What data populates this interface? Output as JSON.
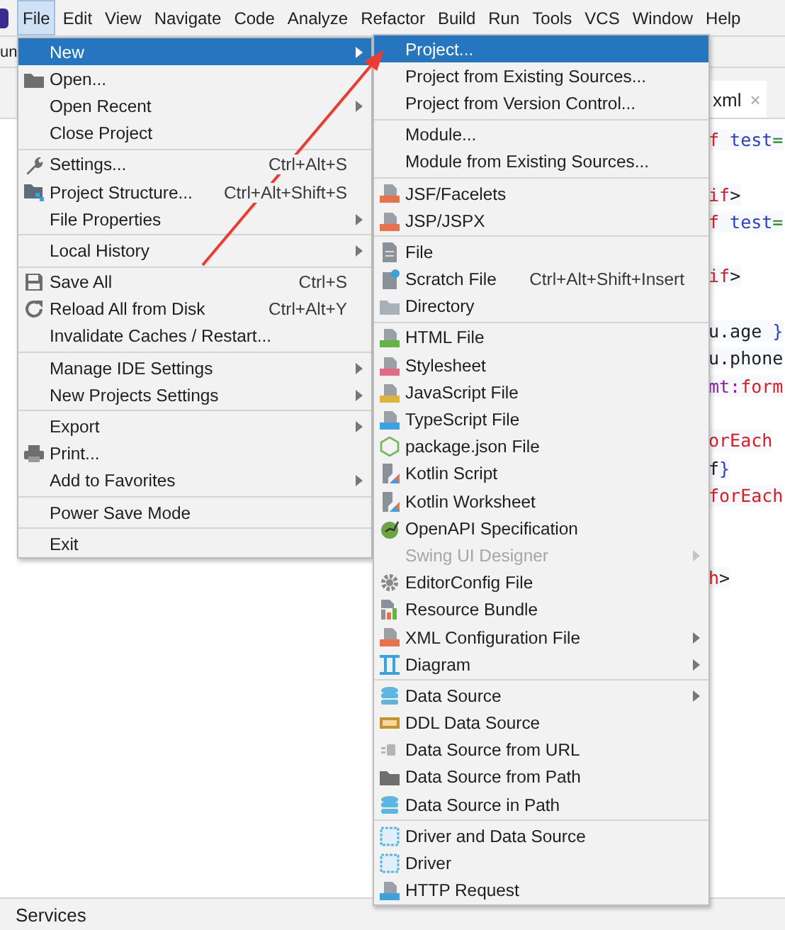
{
  "menu_bar": [
    {
      "label": "File",
      "selected": true
    },
    {
      "label": "Edit",
      "selected": false
    },
    {
      "label": "View",
      "selected": false
    },
    {
      "label": "Navigate",
      "selected": false
    },
    {
      "label": "Code",
      "selected": false
    },
    {
      "label": "Analyze",
      "selected": false
    },
    {
      "label": "Refactor",
      "selected": false
    },
    {
      "label": "Build",
      "selected": false
    },
    {
      "label": "Run",
      "selected": false
    },
    {
      "label": "Tools",
      "selected": false
    },
    {
      "label": "VCS",
      "selected": false
    },
    {
      "label": "Window",
      "selected": false
    },
    {
      "label": "Help",
      "selected": false
    }
  ],
  "toolbar": {
    "text": "un"
  },
  "editor_tab": {
    "label": "xml",
    "close": "×"
  },
  "code_lines": [
    {
      "kind": "code",
      "tokens": [
        {
          "text": "f",
          "kind": "keyword"
        },
        {
          "text": " test",
          "kind": "attribute"
        },
        {
          "text": "=",
          "kind": "operator"
        }
      ]
    },
    {
      "kind": "blank"
    },
    {
      "kind": "code",
      "tokens": [
        {
          "text": "if",
          "kind": "keyword"
        },
        {
          "text": ">",
          "kind": "plain"
        }
      ]
    },
    {
      "kind": "code",
      "tokens": [
        {
          "text": "f",
          "kind": "keyword"
        },
        {
          "text": " test",
          "kind": "attribute"
        },
        {
          "text": "=",
          "kind": "operator"
        }
      ]
    },
    {
      "kind": "blank"
    },
    {
      "kind": "code",
      "tokens": [
        {
          "text": "if",
          "kind": "keyword"
        },
        {
          "text": ">",
          "kind": "plain"
        }
      ]
    },
    {
      "kind": "blank"
    },
    {
      "kind": "code",
      "tokens": [
        {
          "text": "u.age ",
          "kind": "plain"
        },
        {
          "text": "}",
          "kind": "brace"
        }
      ]
    },
    {
      "kind": "code",
      "tokens": [
        {
          "text": "u.phone",
          "kind": "plain"
        }
      ]
    },
    {
      "kind": "code",
      "tokens": [
        {
          "text": "mt:",
          "kind": "namespace"
        },
        {
          "text": "form",
          "kind": "keyword"
        }
      ]
    },
    {
      "kind": "blank"
    },
    {
      "kind": "code",
      "tokens": [
        {
          "text": "orEach",
          "kind": "keyword"
        }
      ]
    },
    {
      "kind": "code",
      "tokens": [
        {
          "text": "f",
          "kind": "plain"
        },
        {
          "text": "}",
          "kind": "brace"
        }
      ]
    },
    {
      "kind": "code",
      "tokens": [
        {
          "text": "forEach",
          "kind": "keyword"
        }
      ]
    },
    {
      "kind": "blank"
    },
    {
      "kind": "blank"
    },
    {
      "kind": "code",
      "tokens": [
        {
          "text": "h",
          "kind": "keyword"
        },
        {
          "text": ">",
          "kind": "plain"
        }
      ]
    }
  ],
  "file_menu": {
    "sections": [
      [
        {
          "label": "New",
          "selected": true,
          "has_submenu": true
        },
        {
          "label": "Open...",
          "selected": false,
          "has_submenu": false
        },
        {
          "label": "Open Recent",
          "selected": false,
          "has_submenu": true
        },
        {
          "label": "Close Project",
          "selected": false,
          "has_submenu": false
        }
      ],
      [
        {
          "label": "Settings...",
          "shortcut": "Ctrl+Alt+S",
          "selected": false,
          "has_submenu": false
        },
        {
          "label": "Project Structure...",
          "shortcut": "Ctrl+Alt+Shift+S",
          "selected": false,
          "has_submenu": false
        },
        {
          "label": "File Properties",
          "selected": false,
          "has_submenu": true
        }
      ],
      [
        {
          "label": "Local History",
          "selected": false,
          "has_submenu": true
        }
      ],
      [
        {
          "label": "Save All",
          "shortcut": "Ctrl+S",
          "selected": false,
          "has_submenu": false
        },
        {
          "label": "Reload All from Disk",
          "shortcut": "Ctrl+Alt+Y",
          "selected": false,
          "has_submenu": false
        },
        {
          "label": "Invalidate Caches / Restart...",
          "selected": false,
          "has_submenu": false
        }
      ],
      [
        {
          "label": "Manage IDE Settings",
          "selected": false,
          "has_submenu": true
        },
        {
          "label": "New Projects Settings",
          "selected": false,
          "has_submenu": true
        }
      ],
      [
        {
          "label": "Export",
          "selected": false,
          "has_submenu": true
        },
        {
          "label": "Print...",
          "selected": false,
          "has_submenu": false
        },
        {
          "label": "Add to Favorites",
          "selected": false,
          "has_submenu": true
        }
      ],
      [
        {
          "label": "Power Save Mode",
          "selected": false,
          "has_submenu": false
        }
      ],
      [
        {
          "label": "Exit",
          "selected": false,
          "has_submenu": false
        }
      ]
    ]
  },
  "new_submenu": {
    "sections": [
      [
        {
          "label": "Project...",
          "selected": true,
          "has_submenu": false,
          "disabled": false
        },
        {
          "label": "Project from Existing Sources...",
          "selected": false,
          "has_submenu": false,
          "disabled": false
        },
        {
          "label": "Project from Version Control...",
          "selected": false,
          "has_submenu": false,
          "disabled": false
        }
      ],
      [
        {
          "label": "Module...",
          "selected": false,
          "has_submenu": false,
          "disabled": false
        },
        {
          "label": "Module from Existing Sources...",
          "selected": false,
          "has_submenu": false,
          "disabled": false
        }
      ],
      [
        {
          "label": "JSF/Facelets",
          "selected": false,
          "has_submenu": false,
          "disabled": false
        },
        {
          "label": "JSP/JSPX",
          "selected": false,
          "has_submenu": false,
          "disabled": false
        }
      ],
      [
        {
          "label": "File",
          "selected": false,
          "has_submenu": false,
          "disabled": false
        },
        {
          "label": "Scratch File",
          "shortcut": "Ctrl+Alt+Shift+Insert",
          "selected": false,
          "has_submenu": false,
          "disabled": false
        },
        {
          "label": "Directory",
          "selected": false,
          "has_submenu": false,
          "disabled": false
        }
      ],
      [
        {
          "label": "HTML File",
          "selected": false,
          "has_submenu": false,
          "disabled": false
        },
        {
          "label": "Stylesheet",
          "selected": false,
          "has_submenu": false,
          "disabled": false
        },
        {
          "label": "JavaScript File",
          "selected": false,
          "has_submenu": false,
          "disabled": false
        },
        {
          "label": "TypeScript File",
          "selected": false,
          "has_submenu": false,
          "disabled": false
        },
        {
          "label": "package.json File",
          "selected": false,
          "has_submenu": false,
          "disabled": false
        },
        {
          "label": "Kotlin Script",
          "selected": false,
          "has_submenu": false,
          "disabled": false
        },
        {
          "label": "Kotlin Worksheet",
          "selected": false,
          "has_submenu": false,
          "disabled": false
        },
        {
          "label": "OpenAPI Specification",
          "selected": false,
          "has_submenu": false,
          "disabled": false
        },
        {
          "label": "Swing UI Designer",
          "selected": false,
          "has_submenu": true,
          "disabled": true
        },
        {
          "label": "EditorConfig File",
          "selected": false,
          "has_submenu": false,
          "disabled": false
        },
        {
          "label": "Resource Bundle",
          "selected": false,
          "has_submenu": false,
          "disabled": false
        },
        {
          "label": "XML Configuration File",
          "selected": false,
          "has_submenu": true,
          "disabled": false
        },
        {
          "label": "Diagram",
          "selected": false,
          "has_submenu": true,
          "disabled": false
        }
      ],
      [
        {
          "label": "Data Source",
          "selected": false,
          "has_submenu": true,
          "disabled": false
        },
        {
          "label": "DDL Data Source",
          "selected": false,
          "has_submenu": false,
          "disabled": false
        },
        {
          "label": "Data Source from URL",
          "selected": false,
          "has_submenu": false,
          "disabled": false
        },
        {
          "label": "Data Source from Path",
          "selected": false,
          "has_submenu": false,
          "disabled": false
        },
        {
          "label": "Data Source in Path",
          "selected": false,
          "has_submenu": false,
          "disabled": false
        }
      ],
      [
        {
          "label": "Driver and Data Source",
          "selected": false,
          "has_submenu": false,
          "disabled": false
        },
        {
          "label": "Driver",
          "selected": false,
          "has_submenu": false,
          "disabled": false
        },
        {
          "label": "HTTP Request",
          "selected": false,
          "has_submenu": false,
          "disabled": false
        }
      ]
    ]
  },
  "status_bar": {
    "label": "Services"
  }
}
